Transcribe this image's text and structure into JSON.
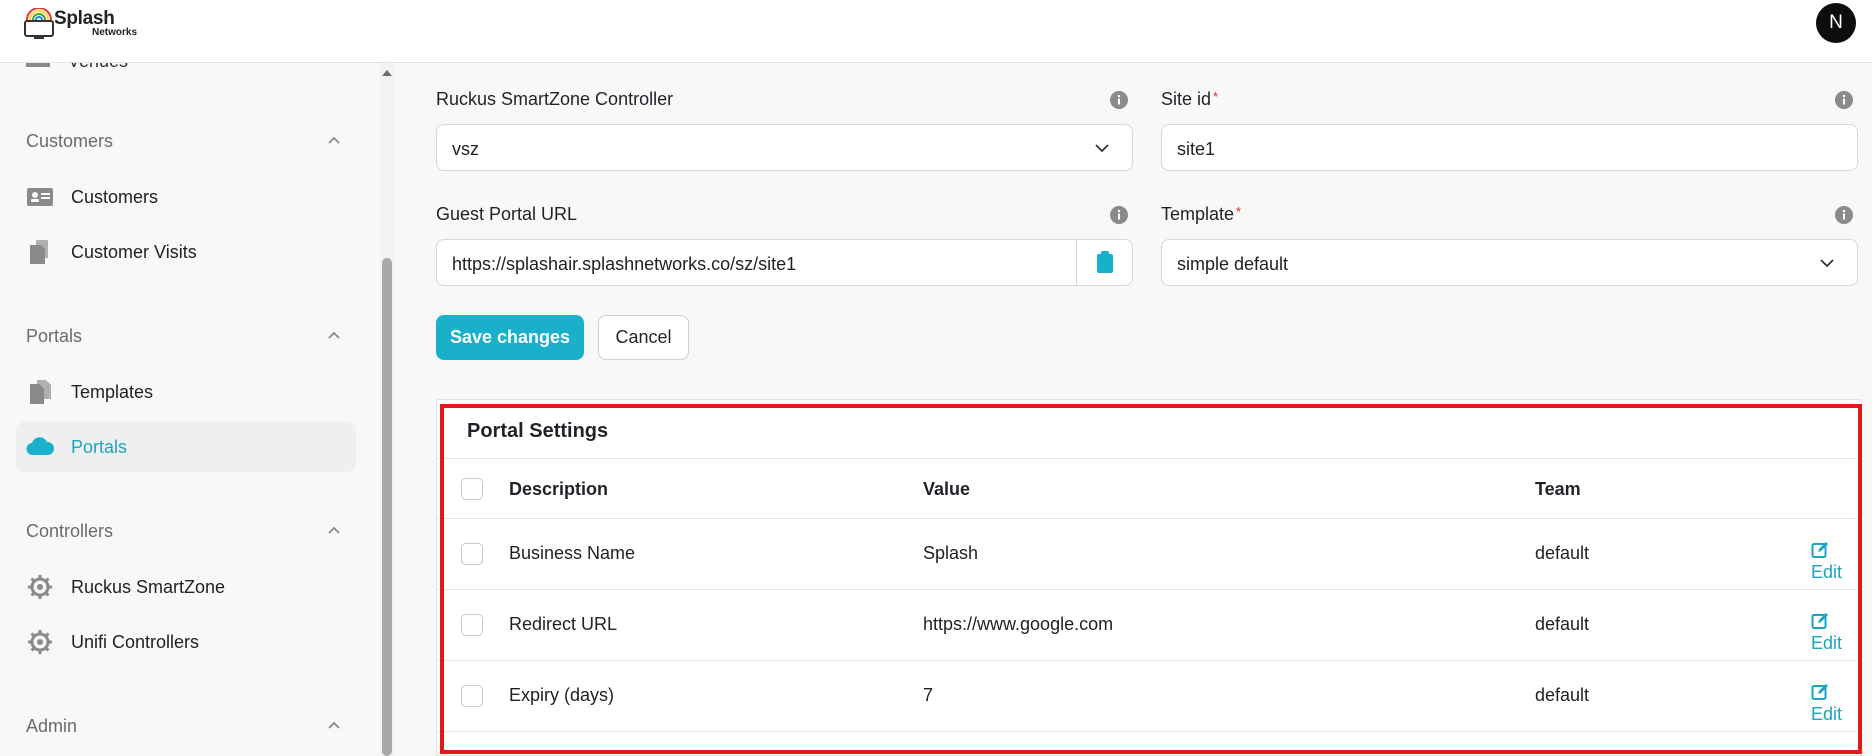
{
  "header": {
    "logo_text": "Splash",
    "logo_sub": "Networks",
    "avatar_initial": "N"
  },
  "sidebar": {
    "partial_item": "Venues",
    "sections": [
      {
        "title": "Customers",
        "items": [
          {
            "label": "Customers",
            "icon": "contact-card-icon"
          },
          {
            "label": "Customer Visits",
            "icon": "documents-icon"
          }
        ]
      },
      {
        "title": "Portals",
        "items": [
          {
            "label": "Templates",
            "icon": "document-copy-icon"
          },
          {
            "label": "Portals",
            "icon": "cloud-icon",
            "active": true
          }
        ]
      },
      {
        "title": "Controllers",
        "items": [
          {
            "label": "Ruckus SmartZone",
            "icon": "gear-icon"
          },
          {
            "label": "Unifi Controllers",
            "icon": "gear-icon"
          }
        ]
      },
      {
        "title": "Admin",
        "items": []
      }
    ]
  },
  "form": {
    "controller_label": "Ruckus SmartZone Controller",
    "controller_value": "vsz",
    "site_id_label": "Site id",
    "site_id_value": "site1",
    "guest_portal_label": "Guest Portal URL",
    "guest_portal_value": "https://splashair.splashnetworks.co/sz/site1",
    "template_label": "Template",
    "template_value": "simple default",
    "required_mark": "*",
    "save_label": "Save changes",
    "cancel_label": "Cancel"
  },
  "portal_settings": {
    "title": "Portal Settings",
    "columns": [
      "Description",
      "Value",
      "Team"
    ],
    "rows": [
      {
        "description": "Business Name",
        "value": "Splash",
        "team": "default",
        "action": "Edit"
      },
      {
        "description": "Redirect URL",
        "value": "https://www.google.com",
        "team": "default",
        "action": "Edit"
      },
      {
        "description": "Expiry (days)",
        "value": "7",
        "team": "default",
        "action": "Edit"
      }
    ]
  },
  "colors": {
    "accent": "#1ab0cc",
    "highlight_border": "#e0191b",
    "required": "#e0292b"
  }
}
